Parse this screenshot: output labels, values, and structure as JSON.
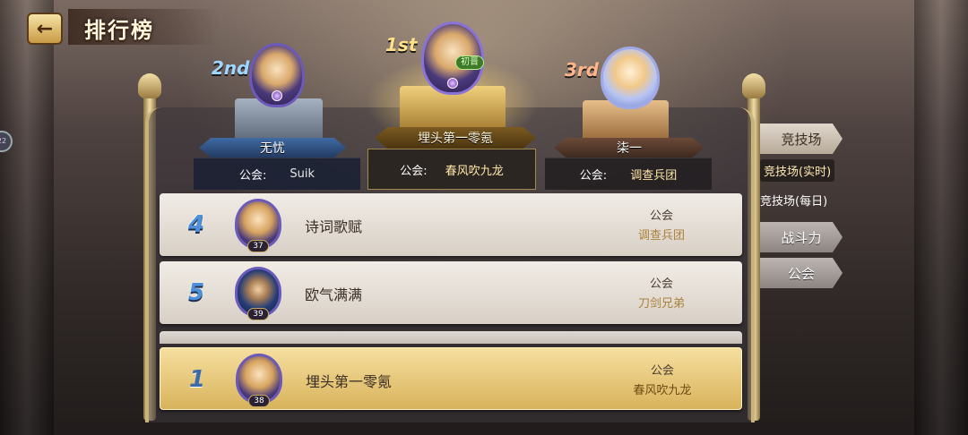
{
  "header": {
    "back_label": "←",
    "title": "排行榜"
  },
  "podium": {
    "guild_label": "公会:",
    "first": {
      "rank_tag": "1st",
      "name": "埋头第一零氪",
      "guild": "春风吹九龙",
      "badge": "初晋"
    },
    "second": {
      "rank_tag": "2nd",
      "name": "无忧",
      "guild": "Suik"
    },
    "third": {
      "rank_tag": "3rd",
      "name": "柒一",
      "guild": "调查兵团"
    }
  },
  "rows": [
    {
      "rank": "4",
      "name": "诗词歌赋",
      "level": "37",
      "guild_label": "公会",
      "guild": "调查兵团",
      "avatar": "blonde-girl"
    },
    {
      "rank": "5",
      "name": "欧气满满",
      "level": "39",
      "guild_label": "公会",
      "guild": "刀剑兄弟",
      "avatar": "wizard-boy"
    }
  ],
  "my_row": {
    "rank": "1",
    "name": "埋头第一零氪",
    "level": "38",
    "guild_label": "公会",
    "guild": "春风吹九龙",
    "avatar": "blonde-girl"
  },
  "side_tabs": {
    "arena": "竞技场",
    "arena_realtime": "竞技场(实时)",
    "arena_daily": "竞技场(每日)",
    "power": "战斗力",
    "guild": "公会"
  },
  "edge_badge": "22",
  "colors": {
    "gold": "#f0d07c",
    "rank_blue": "#4d8fd9",
    "panel_dark": "#1c2234"
  }
}
